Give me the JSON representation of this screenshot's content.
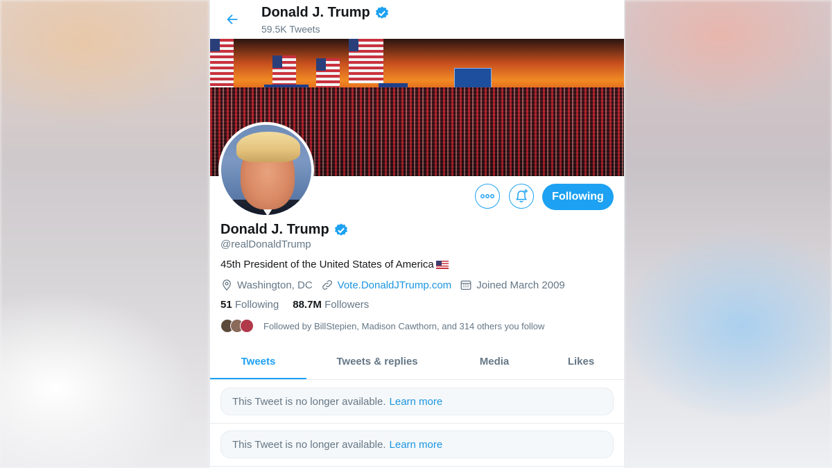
{
  "header": {
    "name": "Donald J. Trump",
    "tweet_count": "59.5K Tweets"
  },
  "profile": {
    "name": "Donald J. Trump",
    "handle": "@realDonaldTrump",
    "bio": "45th President of the United States of America",
    "location": "Washington, DC",
    "website": "Vote.DonaldJTrump.com",
    "joined": "Joined March 2009",
    "following_count": "51",
    "following_label": "Following",
    "followers_count": "88.7M",
    "followers_label": "Followers",
    "followed_by": "Followed by BillStepien, Madison Cawthorn, and 314 others you follow"
  },
  "actions": {
    "following_button": "Following"
  },
  "tabs": [
    {
      "label": "Tweets",
      "active": true
    },
    {
      "label": "Tweets & replies",
      "active": false
    },
    {
      "label": "Media",
      "active": false
    },
    {
      "label": "Likes",
      "active": false
    }
  ],
  "tweets": [
    {
      "text": "This Tweet is no longer available.",
      "link": "Learn more"
    },
    {
      "text": "This Tweet is no longer available.",
      "link": "Learn more"
    }
  ],
  "colors": {
    "accent": "#1da1f2",
    "text": "#14171a",
    "secondary": "#657786"
  }
}
